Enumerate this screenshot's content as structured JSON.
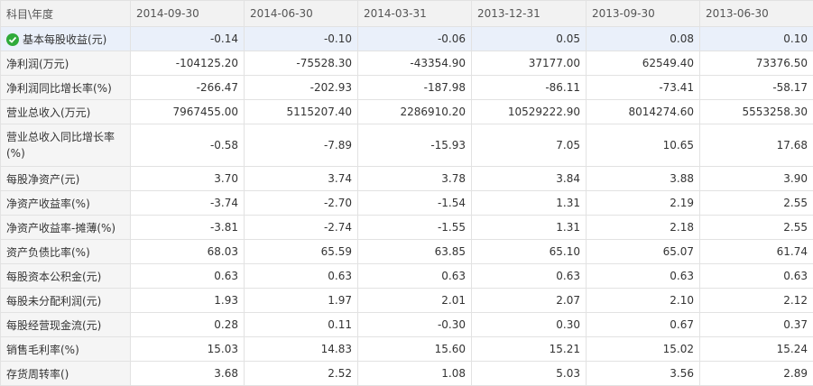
{
  "header": {
    "subject_label": "科目\\年度",
    "periods": [
      "2014-09-30",
      "2014-06-30",
      "2014-03-31",
      "2013-12-31",
      "2013-09-30",
      "2013-06-30"
    ]
  },
  "rows": [
    {
      "label": "基本每股收益(元)",
      "values": [
        "-0.14",
        "-0.10",
        "-0.06",
        "0.05",
        "0.08",
        "0.10"
      ]
    },
    {
      "label": "净利润(万元)",
      "values": [
        "-104125.20",
        "-75528.30",
        "-43354.90",
        "37177.00",
        "62549.40",
        "73376.50"
      ]
    },
    {
      "label": "净利润同比增长率(%)",
      "values": [
        "-266.47",
        "-202.93",
        "-187.98",
        "-86.11",
        "-73.41",
        "-58.17"
      ]
    },
    {
      "label": "营业总收入(万元)",
      "values": [
        "7967455.00",
        "5115207.40",
        "2286910.20",
        "10529222.90",
        "8014274.60",
        "5553258.30"
      ]
    },
    {
      "label": "营业总收入同比增长率(%)",
      "values": [
        "-0.58",
        "-7.89",
        "-15.93",
        "7.05",
        "10.65",
        "17.68"
      ]
    },
    {
      "label": "每股净资产(元)",
      "values": [
        "3.70",
        "3.74",
        "3.78",
        "3.84",
        "3.88",
        "3.90"
      ]
    },
    {
      "label": "净资产收益率(%)",
      "values": [
        "-3.74",
        "-2.70",
        "-1.54",
        "1.31",
        "2.19",
        "2.55"
      ]
    },
    {
      "label": "净资产收益率-摊薄(%)",
      "values": [
        "-3.81",
        "-2.74",
        "-1.55",
        "1.31",
        "2.18",
        "2.55"
      ]
    },
    {
      "label": "资产负债比率(%)",
      "values": [
        "68.03",
        "65.59",
        "63.85",
        "65.10",
        "65.07",
        "61.74"
      ]
    },
    {
      "label": "每股资本公积金(元)",
      "values": [
        "0.63",
        "0.63",
        "0.63",
        "0.63",
        "0.63",
        "0.63"
      ]
    },
    {
      "label": "每股未分配利润(元)",
      "values": [
        "1.93",
        "1.97",
        "2.01",
        "2.07",
        "2.10",
        "2.12"
      ]
    },
    {
      "label": "每股经营现金流(元)",
      "values": [
        "0.28",
        "0.11",
        "-0.30",
        "0.30",
        "0.67",
        "0.37"
      ]
    },
    {
      "label": "销售毛利率(%)",
      "values": [
        "15.03",
        "14.83",
        "15.60",
        "15.21",
        "15.02",
        "15.24"
      ]
    },
    {
      "label": "存货周转率()",
      "values": [
        "3.68",
        "2.52",
        "1.08",
        "5.03",
        "3.56",
        "2.89"
      ]
    }
  ],
  "selected_row_icon": "check-circle-icon",
  "colors": {
    "accent_check": "#2faa3a",
    "selected_row_bg": "#eaf0fa"
  }
}
